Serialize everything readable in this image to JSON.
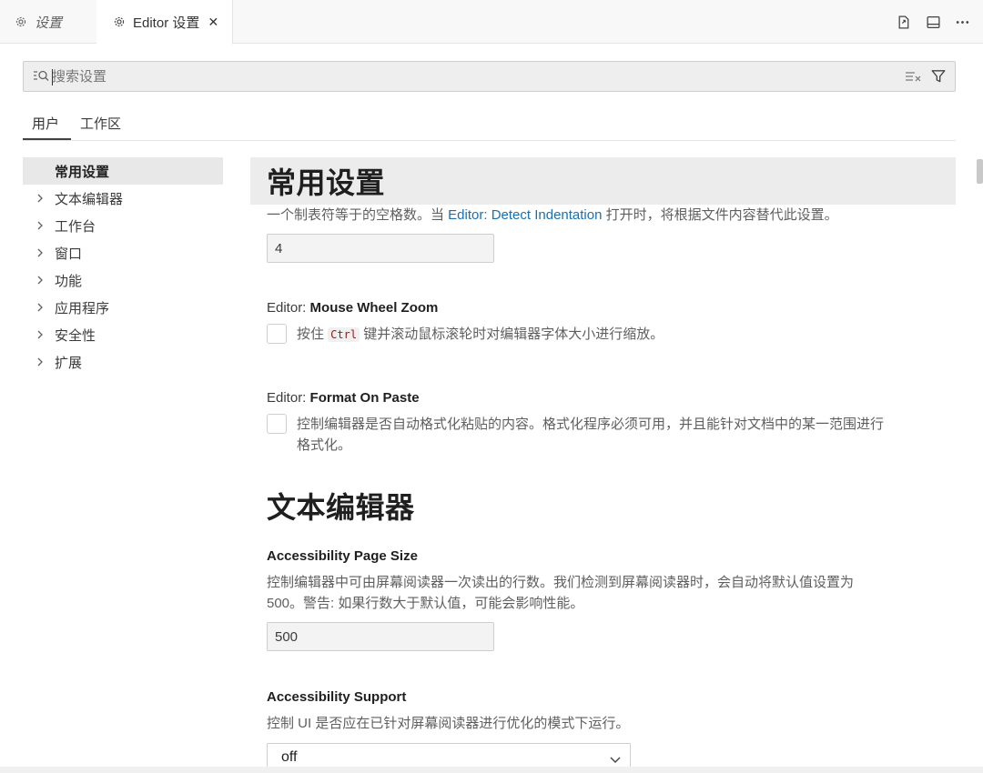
{
  "tabs": [
    {
      "label": "设置",
      "icon": "gear-icon",
      "active": false
    },
    {
      "label": "Editor 设置",
      "icon": "gear-icon",
      "active": true,
      "close": "✕"
    }
  ],
  "actions": [
    {
      "icon": "open-settings-json-icon"
    },
    {
      "icon": "split-editor-icon"
    },
    {
      "icon": "more-actions-icon"
    }
  ],
  "search": {
    "placeholder": "搜索设置",
    "value": ""
  },
  "scopes": [
    {
      "label": "用户",
      "active": true
    },
    {
      "label": "工作区",
      "active": false
    }
  ],
  "toc": [
    {
      "label": "常用设置",
      "selected": true,
      "expandable": false
    },
    {
      "label": "文本编辑器",
      "selected": false,
      "expandable": true
    },
    {
      "label": "工作台",
      "selected": false,
      "expandable": true
    },
    {
      "label": "窗口",
      "selected": false,
      "expandable": true
    },
    {
      "label": "功能",
      "selected": false,
      "expandable": true
    },
    {
      "label": "应用程序",
      "selected": false,
      "expandable": true
    },
    {
      "label": "安全性",
      "selected": false,
      "expandable": true
    },
    {
      "label": "扩展",
      "selected": false,
      "expandable": true
    }
  ],
  "sections": {
    "common": {
      "heading": "常用设置"
    },
    "tabsize": {
      "desc_before": "一个制表符等于的空格数。当 ",
      "desc_link": "Editor: Detect Indentation",
      "desc_after": " 打开时，将根据文件内容替代此设置。",
      "value": "4"
    },
    "mousewheel": {
      "prefix": "Editor: ",
      "name": "Mouse Wheel Zoom",
      "desc_before": "按住 ",
      "desc_code": "Ctrl",
      "desc_after": " 键并滚动鼠标滚轮时对编辑器字体大小进行缩放。",
      "checked": false
    },
    "formatpaste": {
      "prefix": "Editor: ",
      "name": "Format On Paste",
      "desc_line1": "控制编辑器是否自动格式化粘贴的内容。格式化程序必须可用，并且能针对文档中的某一范围进行",
      "desc_line2": "格式化。",
      "checked": false
    },
    "texteditor": {
      "heading": "文本编辑器"
    },
    "pagesize": {
      "name": "Accessibility Page Size",
      "desc_line1": "控制编辑器中可由屏幕阅读器一次读出的行数。我们检测到屏幕阅读器时，会自动将默认值设置为",
      "desc_line2": "500。警告: 如果行数大于默认值，可能会影响性能。",
      "value": "500"
    },
    "support": {
      "name": "Accessibility Support",
      "desc": "控制 UI 是否应在已针对屏幕阅读器进行优化的模式下运行。",
      "value": "off"
    }
  }
}
